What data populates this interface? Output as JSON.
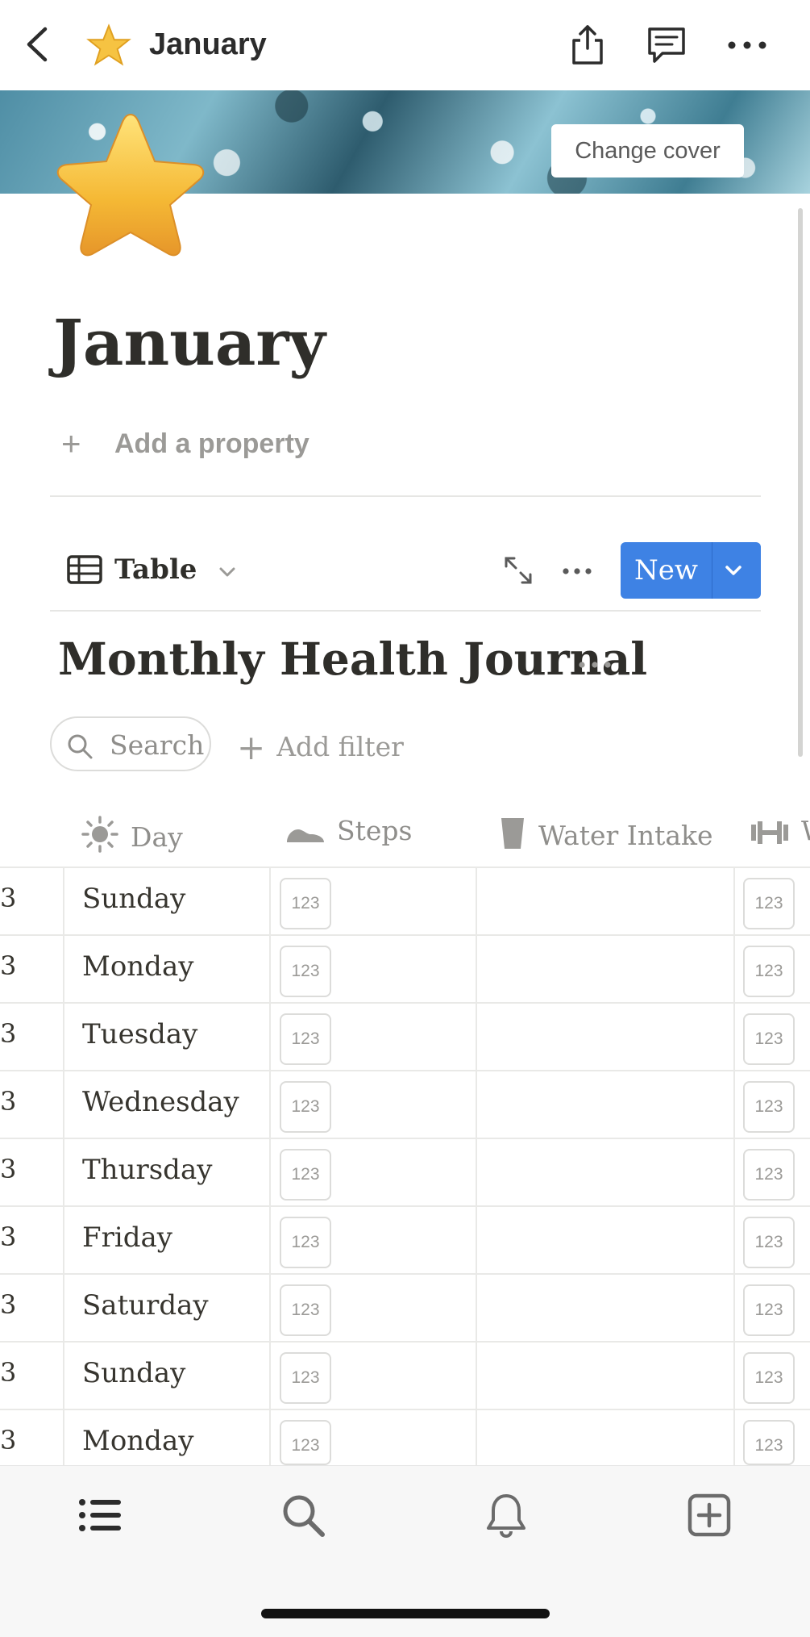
{
  "nav": {
    "title": "January",
    "icons": [
      "back-chevron-icon",
      "star-emoji-icon",
      "share-icon",
      "comment-icon",
      "more-icon"
    ]
  },
  "cover": {
    "change_label": "Change cover"
  },
  "page": {
    "title": "January",
    "add_property_label": "Add a property"
  },
  "view": {
    "tab_label": "Table",
    "new_label": "New"
  },
  "database": {
    "title": "Monthly Health Journal",
    "search_label": "Search",
    "add_filter_label": "Add filter",
    "columns": [
      {
        "label": "Day",
        "icon": "sun-icon"
      },
      {
        "label": "Steps",
        "icon": "shoe-icon"
      },
      {
        "label": "Water Intake",
        "icon": "glass-icon"
      },
      {
        "label": "W",
        "icon": "dumbbell-icon"
      }
    ],
    "row_prefix": "3",
    "number_placeholder": "123",
    "rows": [
      "Sunday",
      "Monday",
      "Tuesday",
      "Wednesday",
      "Thursday",
      "Friday",
      "Saturday",
      "Sunday",
      "Monday"
    ]
  },
  "colors": {
    "accent": "#3e82e4",
    "text": "#37352f",
    "muted": "#9b9a97"
  },
  "tabbar": {
    "items": [
      "list-icon",
      "search-icon",
      "bell-icon",
      "new-page-icon"
    ]
  }
}
